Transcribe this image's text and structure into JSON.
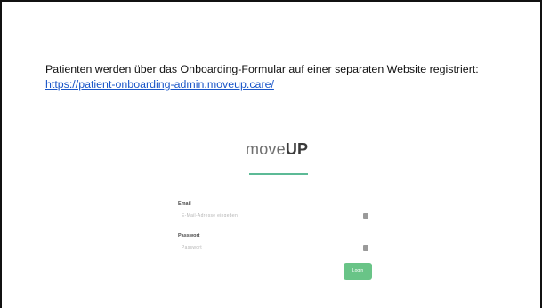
{
  "intro": {
    "text": "Patienten werden über das Onboarding-Formular auf einer separaten Website registriert:",
    "link": "https://patient-onboarding-admin.moveup.care/"
  },
  "embedded_screenshot": {
    "logo_prefix": "move",
    "logo_suffix": "UP",
    "email_label": "Email",
    "email_placeholder": "E-Mail-Adresse eingeben",
    "password_label": "Passwort",
    "password_placeholder": "Passwort",
    "login_button": "Login",
    "accent_color": "#69c487"
  }
}
